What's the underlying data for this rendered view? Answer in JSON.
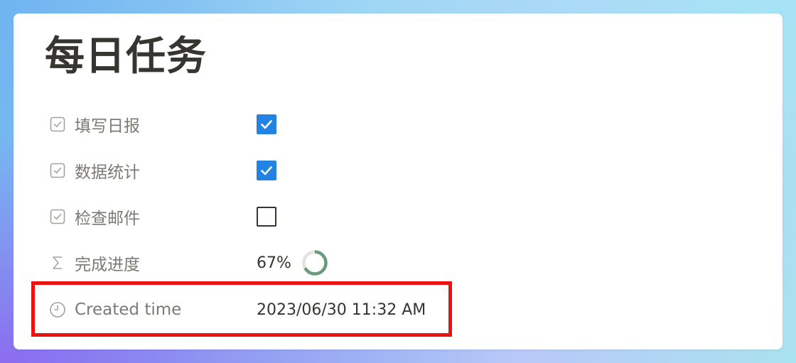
{
  "page": {
    "title": "每日任务"
  },
  "properties": [
    {
      "name": "填写日报",
      "icon": "checkbox-property-icon",
      "type": "checkbox",
      "checked": true
    },
    {
      "name": "数据统计",
      "icon": "checkbox-property-icon",
      "type": "checkbox",
      "checked": true
    },
    {
      "name": "检查邮件",
      "icon": "checkbox-property-icon",
      "type": "checkbox",
      "checked": false
    },
    {
      "name": "完成进度",
      "icon": "sigma-formula-icon",
      "type": "formula",
      "value": "67%",
      "progress": 0.67
    },
    {
      "name": "Created time",
      "icon": "clock-icon",
      "type": "created_time",
      "value": "2023/06/30 11:32 AM"
    }
  ],
  "colors": {
    "accent": "#2383e2",
    "progress_ring": "#6a9a7c",
    "progress_track": "#e3e2e0",
    "highlight_box": "#ee1111",
    "text": "#37352f",
    "muted_text": "#7d7a75"
  }
}
